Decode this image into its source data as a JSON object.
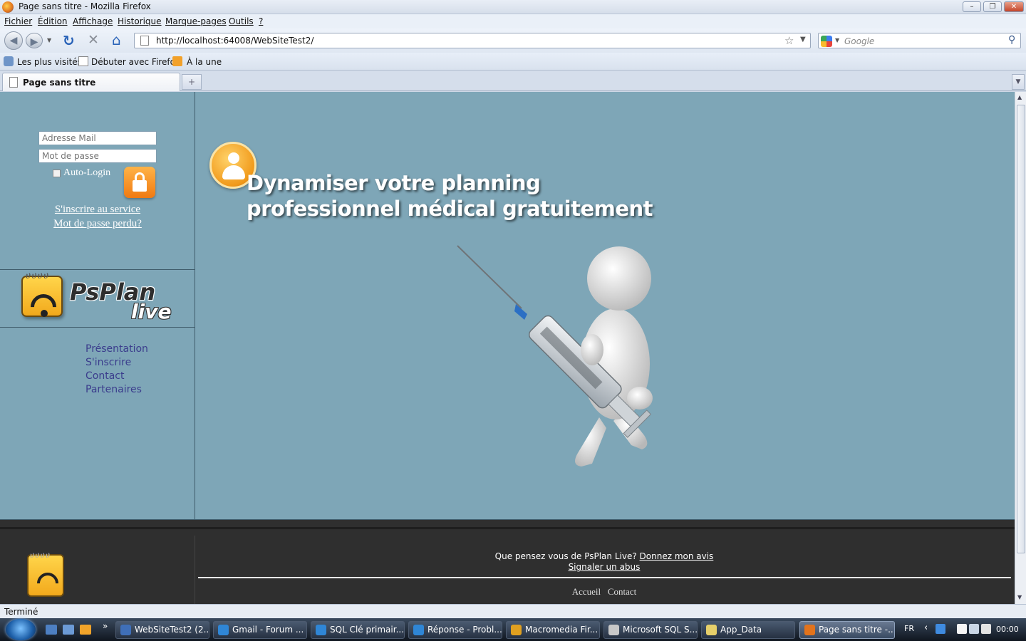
{
  "window": {
    "title": "Page sans titre - Mozilla Firefox",
    "controls": {
      "minimize": "–",
      "maximize": "❐",
      "close": "✕"
    }
  },
  "menu": [
    "Fichier",
    "Édition",
    "Affichage",
    "Historique",
    "Marque-pages",
    "Outils",
    "?"
  ],
  "navbar": {
    "url": "http://localhost:64008/WebSiteTest2/",
    "search_placeholder": "Google"
  },
  "bookmarks": [
    "Les plus visités",
    "Débuter avec Firefox",
    "À la une"
  ],
  "tabs": [
    {
      "label": "Page sans titre",
      "active": true
    }
  ],
  "login": {
    "email_placeholder": "Adresse Mail",
    "password_placeholder": "Mot de passe",
    "autologin_label": "Auto-Login",
    "register_link": "S'inscrire au service",
    "lost_password_link": "Mot de passe perdu?"
  },
  "logo": {
    "word1": "PsPlan",
    "word2": "live"
  },
  "site_nav": [
    "Présentation",
    "S'inscrire",
    "Contact",
    "Partenaires"
  ],
  "hero": {
    "line1": "Dynamiser votre planning",
    "line2": "professionnel médical gratuitement"
  },
  "footer": {
    "question": "Que pensez vous de PsPlan Live?",
    "feedback_link": "Donnez mon avis",
    "abuse_link": "Signaler un abus",
    "links": [
      "Accueil",
      "Contact"
    ]
  },
  "status": "Terminé",
  "taskbar": {
    "tasks": [
      {
        "label": "WebSiteTest2 (2...",
        "color": "#3f6fb8"
      },
      {
        "label": "Gmail - Forum ...",
        "color": "#2f86d6"
      },
      {
        "label": "SQL Clé primair...",
        "color": "#2f86d6"
      },
      {
        "label": "Réponse - Probl...",
        "color": "#2f86d6"
      },
      {
        "label": "Macromedia Fir...",
        "color": "#e0a020"
      },
      {
        "label": "Microsoft SQL S...",
        "color": "#c8c8c8"
      },
      {
        "label": "App_Data",
        "color": "#e6cf6a"
      },
      {
        "label": "Page sans titre -...",
        "color": "#e2731c",
        "active": true
      }
    ],
    "language": "FR",
    "clock": "00:00"
  },
  "colors": {
    "page_background": "#7ea6b7",
    "nav_link": "#3b3d8d",
    "footer_background": "#2f2f2f",
    "accent_orange": "#f19a1b"
  }
}
